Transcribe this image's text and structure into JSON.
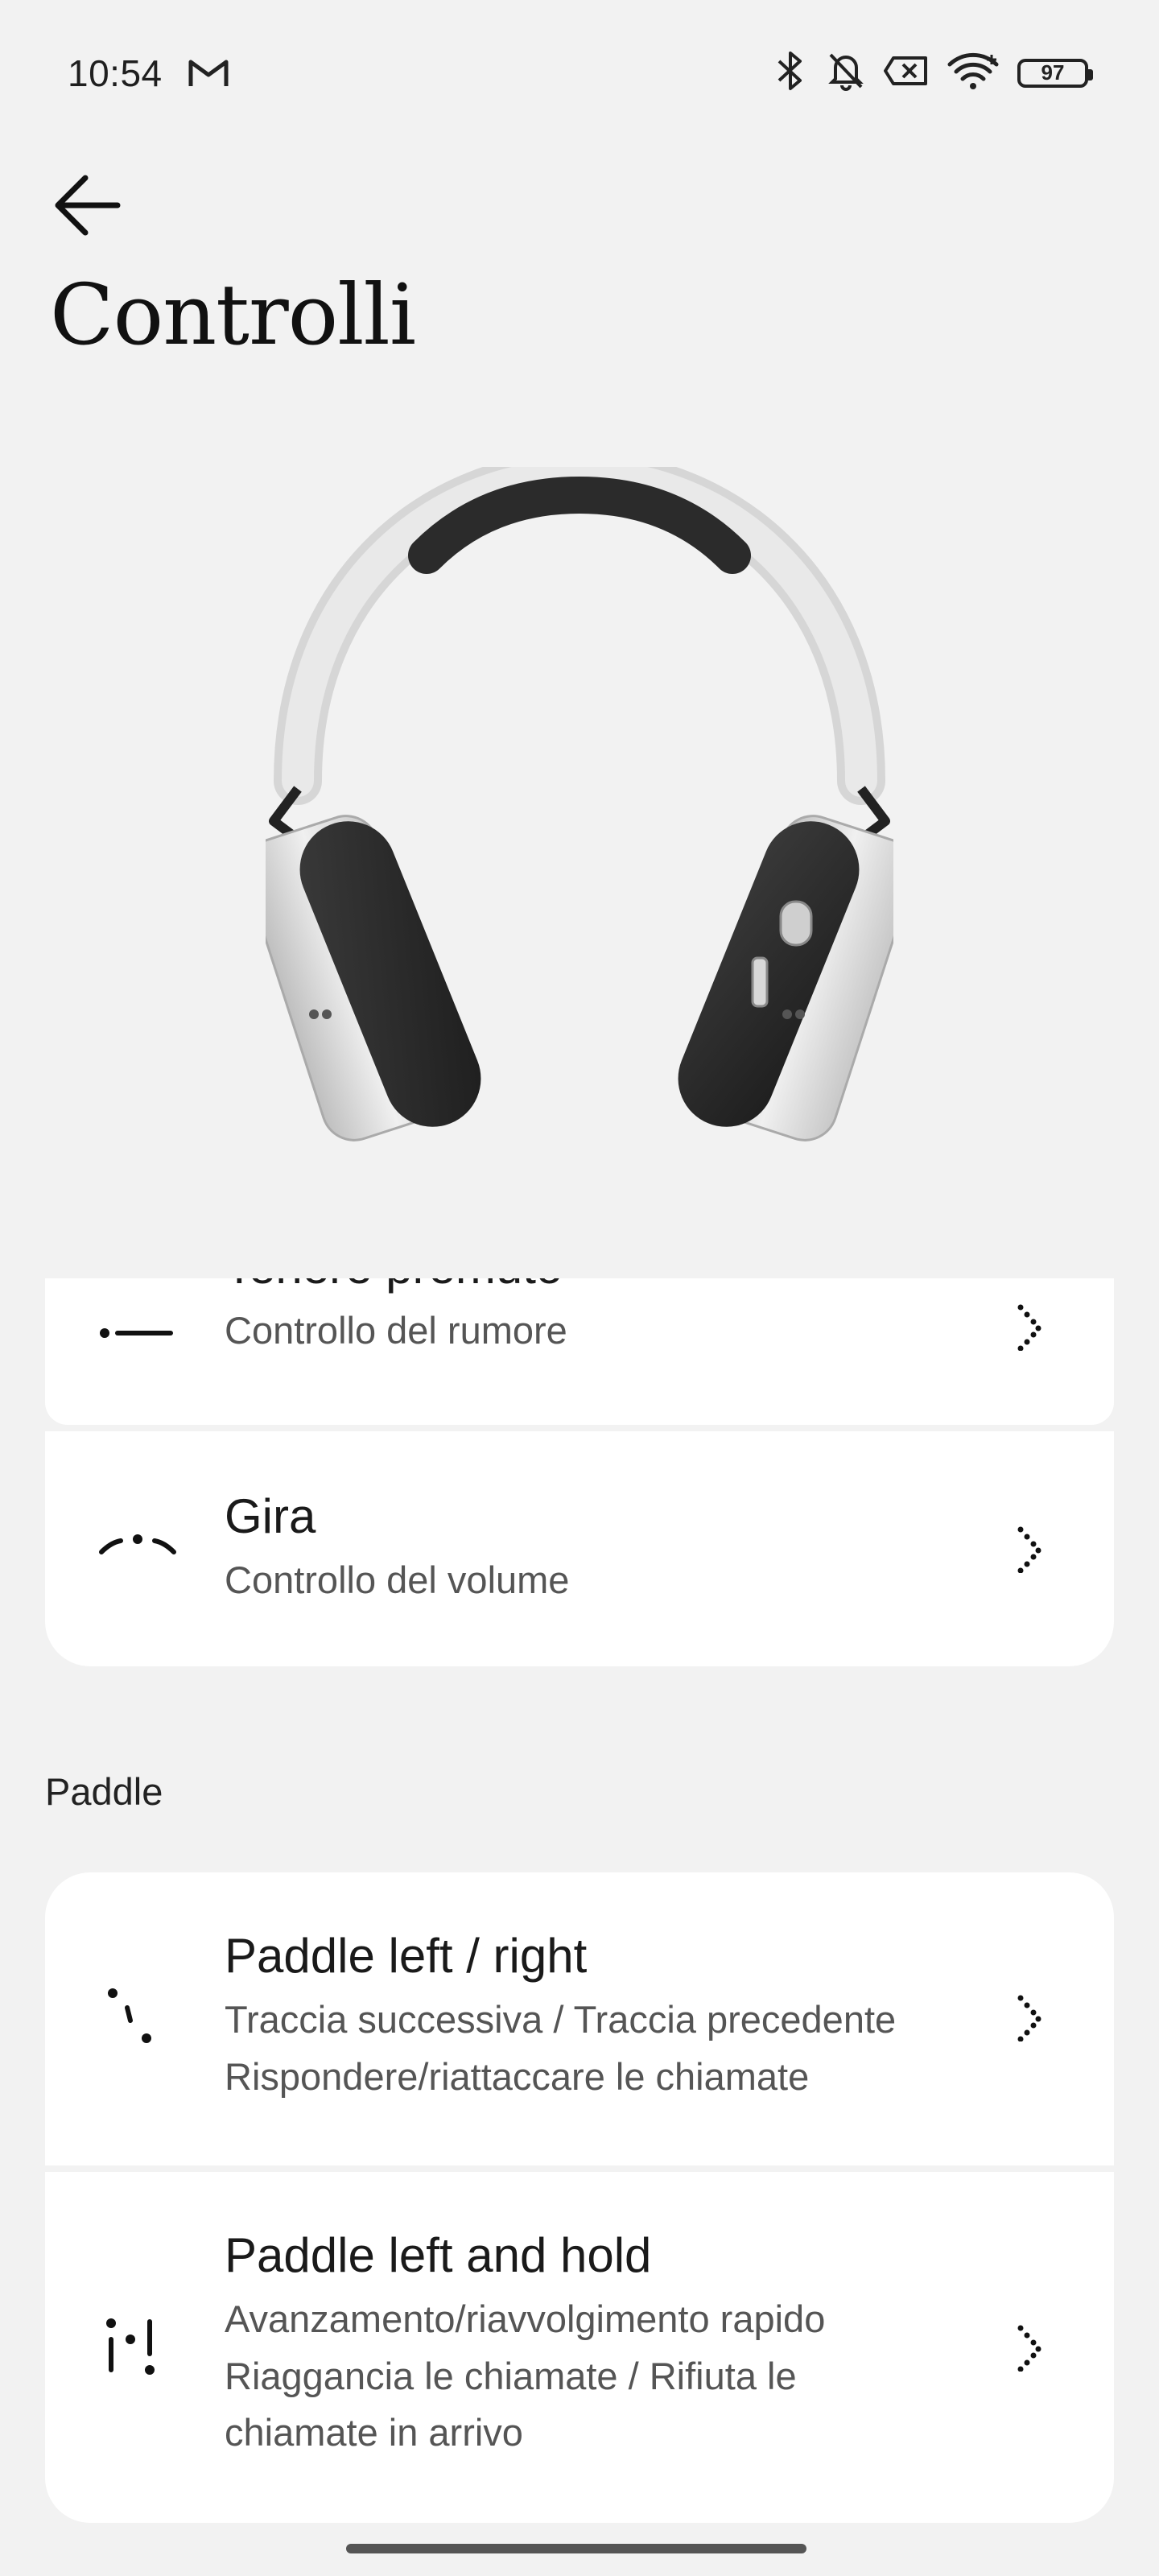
{
  "status_bar": {
    "time": "10:54",
    "battery": "97"
  },
  "header": {
    "title": "Controlli"
  },
  "rows": {
    "hold": {
      "title": "Tenere premuto",
      "subtitle": "Controllo del rumore"
    },
    "turn": {
      "title": "Gira",
      "subtitle": "Controllo del volume"
    }
  },
  "paddle": {
    "label": "Paddle",
    "items": [
      {
        "title": "Paddle left / right",
        "lines": [
          "Traccia successiva / Traccia precedente",
          "Rispondere/riattaccare le chiamate"
        ]
      },
      {
        "title": "Paddle left and hold",
        "lines": [
          "Avanzamento/riavvolgimento rapido",
          "Riaggancia le chiamate / Rifiuta le",
          "chiamate in arrivo"
        ]
      }
    ]
  },
  "colors": {
    "background": "#f2f2f2",
    "card": "#ffffff",
    "text": "#1a1a1a",
    "subtext": "#555555"
  }
}
